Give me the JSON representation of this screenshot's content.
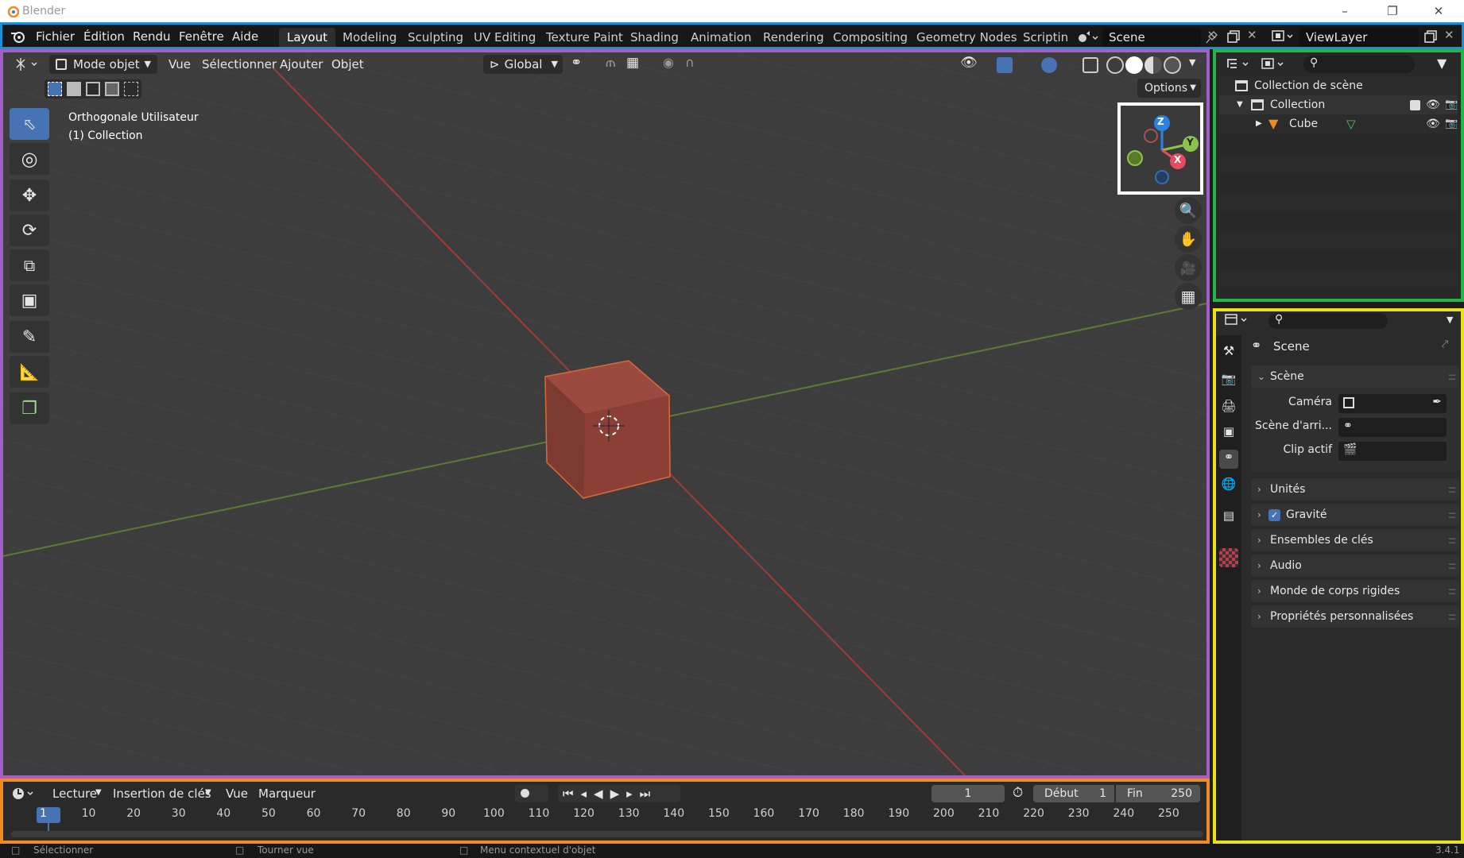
{
  "window": {
    "title": "Blender"
  },
  "menu": [
    "Fichier",
    "Édition",
    "Rendu",
    "Fenêtre",
    "Aide"
  ],
  "workspaces": [
    "Layout",
    "Modeling",
    "Sculpting",
    "UV Editing",
    "Texture Paint",
    "Shading",
    "Animation",
    "Rendering",
    "Compositing",
    "Geometry Nodes",
    "Scripting"
  ],
  "active_workspace": "Layout",
  "scene": {
    "name": "Scene"
  },
  "view_layer": {
    "name": "ViewLayer"
  },
  "viewport": {
    "mode": "Mode objet",
    "menus": [
      "Vue",
      "Sélectionner",
      "Ajouter",
      "Objet"
    ],
    "transform_orientation": "Global",
    "options_label": "Options",
    "view_name": "Orthogonale Utilisateur",
    "collection_info": "(1) Collection",
    "gizmo_axes": {
      "x": "X",
      "y": "Y",
      "z": "Z"
    },
    "colors": {
      "x_axis": "#e84a5f",
      "y_axis": "#8bc34a",
      "z_axis": "#2c82e0",
      "cube": "#8f3f35"
    }
  },
  "timeline": {
    "menus": [
      "Lecture",
      "Insertion de clés",
      "Vue",
      "Marqueur"
    ],
    "current_frame": "1",
    "start_label": "Début",
    "start_value": "1",
    "end_label": "Fin",
    "end_value": "250",
    "ticks": [
      "1",
      "10",
      "20",
      "30",
      "40",
      "50",
      "60",
      "70",
      "80",
      "90",
      "100",
      "110",
      "120",
      "130",
      "140",
      "150",
      "160",
      "170",
      "180",
      "190",
      "200",
      "210",
      "220",
      "230",
      "240",
      "250"
    ]
  },
  "statusbar": {
    "left": "Sélectionner",
    "middle": "Tourner vue",
    "right": "Menu contextuel d'objet",
    "version": "3.4.1"
  },
  "outliner": {
    "root": "Collection de scène",
    "collection": "Collection",
    "object": "Cube"
  },
  "properties": {
    "context_title": "Scene",
    "scene_panel": "Scène",
    "fields": [
      {
        "label": "Caméra"
      },
      {
        "label": "Scène d'arri..."
      },
      {
        "label": "Clip actif"
      }
    ],
    "panels": [
      "Unités",
      "Gravité",
      "Ensembles de clés",
      "Audio",
      "Monde de corps rigides",
      "Propriétés personnalisées"
    ]
  }
}
